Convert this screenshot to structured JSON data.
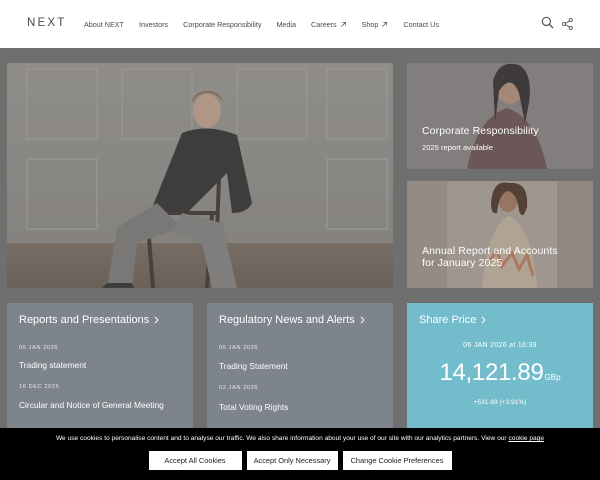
{
  "header": {
    "logo": "NEXT",
    "nav": [
      {
        "label": "About NEXT",
        "external": false
      },
      {
        "label": "Investors",
        "external": false
      },
      {
        "label": "Corporate Responsibility",
        "external": false
      },
      {
        "label": "Media",
        "external": false
      },
      {
        "label": "Careers",
        "external": true
      },
      {
        "label": "Shop",
        "external": true
      },
      {
        "label": "Contact Us",
        "external": false
      }
    ]
  },
  "tiles": {
    "corporate": {
      "title": "Corporate Responsibility",
      "subtitle": "2025 report available"
    },
    "annual": {
      "title_line1": "Annual Report and Accounts",
      "title_line2": "for January 2025"
    }
  },
  "reports": {
    "title": "Reports and Presentations",
    "items": [
      {
        "date": "06 JAN 2026",
        "title": "Trading statement"
      },
      {
        "date": "16 DEC 2025",
        "title": "Circular and Notice of General Meeting"
      }
    ]
  },
  "regulatory": {
    "title": "Regulatory News and Alerts",
    "items": [
      {
        "date": "06 JAN 2026",
        "title": "Trading Statement"
      },
      {
        "date": "02 JAN 2026",
        "title": "Total Voting Rights"
      }
    ]
  },
  "share": {
    "title": "Share Price",
    "date": "06 JAN 2026 at 16:39",
    "price": "14,121.89",
    "unit": "GBp",
    "change": "+531.89 (+3.91%)"
  },
  "cookie": {
    "text": "We use cookies to personalise content and to analyse our traffic. We also share information about your use of our site with our analytics partners. View our",
    "link": "cookie page",
    "accept_all": "Accept All Cookies",
    "accept_necessary": "Accept Only Necessary",
    "change": "Change Cookie Preferences"
  },
  "colors": {
    "share_card": "#73bccc",
    "card": "#7d848c",
    "overlay": "#6f6f6f"
  }
}
